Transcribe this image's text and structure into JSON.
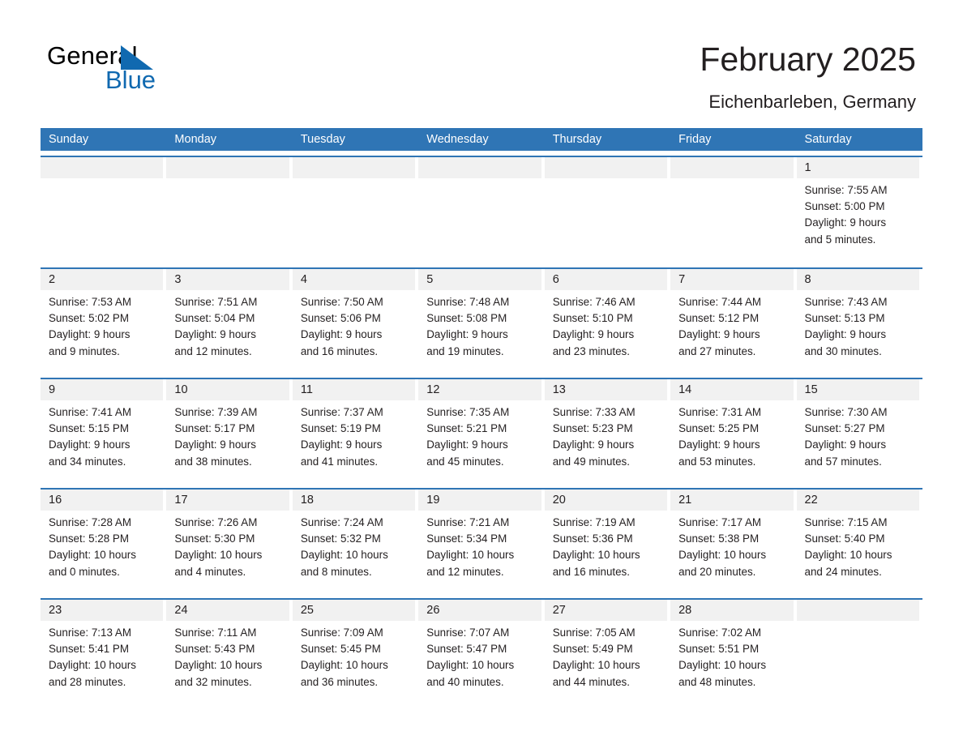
{
  "brand": {
    "name_part1": "General",
    "name_part2": "Blue",
    "triangle_color": "#1069b0"
  },
  "header": {
    "title": "February 2025",
    "subtitle": "Eichenbarleben, Germany",
    "header_bg": "#2f75b5",
    "daynum_bg": "#f1f1f1"
  },
  "weekdays": [
    {
      "label": "Sunday"
    },
    {
      "label": "Monday"
    },
    {
      "label": "Tuesday"
    },
    {
      "label": "Wednesday"
    },
    {
      "label": "Thursday"
    },
    {
      "label": "Friday"
    },
    {
      "label": "Saturday"
    }
  ],
  "weeks": [
    [
      {
        "day": "",
        "sunrise": "",
        "sunset": "",
        "daylight1": "",
        "daylight2": ""
      },
      {
        "day": "",
        "sunrise": "",
        "sunset": "",
        "daylight1": "",
        "daylight2": ""
      },
      {
        "day": "",
        "sunrise": "",
        "sunset": "",
        "daylight1": "",
        "daylight2": ""
      },
      {
        "day": "",
        "sunrise": "",
        "sunset": "",
        "daylight1": "",
        "daylight2": ""
      },
      {
        "day": "",
        "sunrise": "",
        "sunset": "",
        "daylight1": "",
        "daylight2": ""
      },
      {
        "day": "",
        "sunrise": "",
        "sunset": "",
        "daylight1": "",
        "daylight2": ""
      },
      {
        "day": "1",
        "sunrise": "Sunrise: 7:55 AM",
        "sunset": "Sunset: 5:00 PM",
        "daylight1": "Daylight: 9 hours",
        "daylight2": "and 5 minutes."
      }
    ],
    [
      {
        "day": "2",
        "sunrise": "Sunrise: 7:53 AM",
        "sunset": "Sunset: 5:02 PM",
        "daylight1": "Daylight: 9 hours",
        "daylight2": "and 9 minutes."
      },
      {
        "day": "3",
        "sunrise": "Sunrise: 7:51 AM",
        "sunset": "Sunset: 5:04 PM",
        "daylight1": "Daylight: 9 hours",
        "daylight2": "and 12 minutes."
      },
      {
        "day": "4",
        "sunrise": "Sunrise: 7:50 AM",
        "sunset": "Sunset: 5:06 PM",
        "daylight1": "Daylight: 9 hours",
        "daylight2": "and 16 minutes."
      },
      {
        "day": "5",
        "sunrise": "Sunrise: 7:48 AM",
        "sunset": "Sunset: 5:08 PM",
        "daylight1": "Daylight: 9 hours",
        "daylight2": "and 19 minutes."
      },
      {
        "day": "6",
        "sunrise": "Sunrise: 7:46 AM",
        "sunset": "Sunset: 5:10 PM",
        "daylight1": "Daylight: 9 hours",
        "daylight2": "and 23 minutes."
      },
      {
        "day": "7",
        "sunrise": "Sunrise: 7:44 AM",
        "sunset": "Sunset: 5:12 PM",
        "daylight1": "Daylight: 9 hours",
        "daylight2": "and 27 minutes."
      },
      {
        "day": "8",
        "sunrise": "Sunrise: 7:43 AM",
        "sunset": "Sunset: 5:13 PM",
        "daylight1": "Daylight: 9 hours",
        "daylight2": "and 30 minutes."
      }
    ],
    [
      {
        "day": "9",
        "sunrise": "Sunrise: 7:41 AM",
        "sunset": "Sunset: 5:15 PM",
        "daylight1": "Daylight: 9 hours",
        "daylight2": "and 34 minutes."
      },
      {
        "day": "10",
        "sunrise": "Sunrise: 7:39 AM",
        "sunset": "Sunset: 5:17 PM",
        "daylight1": "Daylight: 9 hours",
        "daylight2": "and 38 minutes."
      },
      {
        "day": "11",
        "sunrise": "Sunrise: 7:37 AM",
        "sunset": "Sunset: 5:19 PM",
        "daylight1": "Daylight: 9 hours",
        "daylight2": "and 41 minutes."
      },
      {
        "day": "12",
        "sunrise": "Sunrise: 7:35 AM",
        "sunset": "Sunset: 5:21 PM",
        "daylight1": "Daylight: 9 hours",
        "daylight2": "and 45 minutes."
      },
      {
        "day": "13",
        "sunrise": "Sunrise: 7:33 AM",
        "sunset": "Sunset: 5:23 PM",
        "daylight1": "Daylight: 9 hours",
        "daylight2": "and 49 minutes."
      },
      {
        "day": "14",
        "sunrise": "Sunrise: 7:31 AM",
        "sunset": "Sunset: 5:25 PM",
        "daylight1": "Daylight: 9 hours",
        "daylight2": "and 53 minutes."
      },
      {
        "day": "15",
        "sunrise": "Sunrise: 7:30 AM",
        "sunset": "Sunset: 5:27 PM",
        "daylight1": "Daylight: 9 hours",
        "daylight2": "and 57 minutes."
      }
    ],
    [
      {
        "day": "16",
        "sunrise": "Sunrise: 7:28 AM",
        "sunset": "Sunset: 5:28 PM",
        "daylight1": "Daylight: 10 hours",
        "daylight2": "and 0 minutes."
      },
      {
        "day": "17",
        "sunrise": "Sunrise: 7:26 AM",
        "sunset": "Sunset: 5:30 PM",
        "daylight1": "Daylight: 10 hours",
        "daylight2": "and 4 minutes."
      },
      {
        "day": "18",
        "sunrise": "Sunrise: 7:24 AM",
        "sunset": "Sunset: 5:32 PM",
        "daylight1": "Daylight: 10 hours",
        "daylight2": "and 8 minutes."
      },
      {
        "day": "19",
        "sunrise": "Sunrise: 7:21 AM",
        "sunset": "Sunset: 5:34 PM",
        "daylight1": "Daylight: 10 hours",
        "daylight2": "and 12 minutes."
      },
      {
        "day": "20",
        "sunrise": "Sunrise: 7:19 AM",
        "sunset": "Sunset: 5:36 PM",
        "daylight1": "Daylight: 10 hours",
        "daylight2": "and 16 minutes."
      },
      {
        "day": "21",
        "sunrise": "Sunrise: 7:17 AM",
        "sunset": "Sunset: 5:38 PM",
        "daylight1": "Daylight: 10 hours",
        "daylight2": "and 20 minutes."
      },
      {
        "day": "22",
        "sunrise": "Sunrise: 7:15 AM",
        "sunset": "Sunset: 5:40 PM",
        "daylight1": "Daylight: 10 hours",
        "daylight2": "and 24 minutes."
      }
    ],
    [
      {
        "day": "23",
        "sunrise": "Sunrise: 7:13 AM",
        "sunset": "Sunset: 5:41 PM",
        "daylight1": "Daylight: 10 hours",
        "daylight2": "and 28 minutes."
      },
      {
        "day": "24",
        "sunrise": "Sunrise: 7:11 AM",
        "sunset": "Sunset: 5:43 PM",
        "daylight1": "Daylight: 10 hours",
        "daylight2": "and 32 minutes."
      },
      {
        "day": "25",
        "sunrise": "Sunrise: 7:09 AM",
        "sunset": "Sunset: 5:45 PM",
        "daylight1": "Daylight: 10 hours",
        "daylight2": "and 36 minutes."
      },
      {
        "day": "26",
        "sunrise": "Sunrise: 7:07 AM",
        "sunset": "Sunset: 5:47 PM",
        "daylight1": "Daylight: 10 hours",
        "daylight2": "and 40 minutes."
      },
      {
        "day": "27",
        "sunrise": "Sunrise: 7:05 AM",
        "sunset": "Sunset: 5:49 PM",
        "daylight1": "Daylight: 10 hours",
        "daylight2": "and 44 minutes."
      },
      {
        "day": "28",
        "sunrise": "Sunrise: 7:02 AM",
        "sunset": "Sunset: 5:51 PM",
        "daylight1": "Daylight: 10 hours",
        "daylight2": "and 48 minutes."
      },
      {
        "day": "",
        "sunrise": "",
        "sunset": "",
        "daylight1": "",
        "daylight2": ""
      }
    ]
  ]
}
